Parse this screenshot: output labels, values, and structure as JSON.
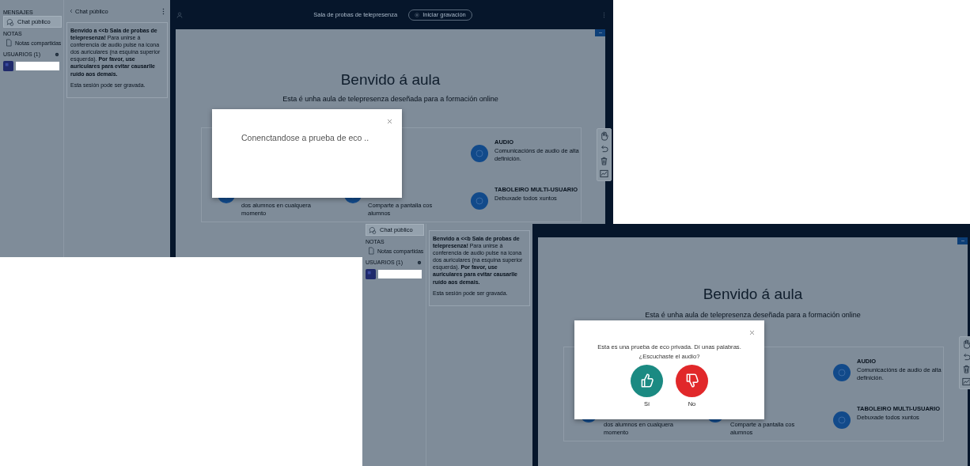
{
  "screenshots": [
    {
      "top_bar": {
        "title": "Sala de probas de telepresenza",
        "record_button": "Iniciar gravación"
      },
      "sidebar": {
        "messages_heading": "MENSAJES",
        "chat_item": {
          "label": "Chat público",
          "selected": true
        },
        "notes_heading": "NOTAS",
        "notes_item": "Notas compartidas",
        "users_heading": "USUARIOS (1)"
      },
      "chat": {
        "header": "Chat público",
        "messages": [
          "**Benvido a <<b Sala de probas de telepresenza!** Para unirse á conferencia de audio pulse na icona dos auriculares (na esquina superior esquerda). **Por favor, use auriculares para evitar causarlle ruído aos demais.**",
          "Esta sesión pode ser gravada."
        ]
      },
      "presentation": {
        "title": "Benvido á aula",
        "subtitle": "Esta é unha aula de telepresenza deseñada para a formación online",
        "features": [
          {
            "description": "dos alumnos en cualquera momento"
          },
          {
            "description": "Comparte a pantalla cos alumnos"
          },
          {
            "title": "AUDIO",
            "description": "Comunicacións de audio de alta definición."
          },
          {
            "title": "TABOLEIRO MULTI-USUARIO",
            "description": "Debuxade todos xuntos"
          }
        ]
      },
      "modal": {
        "kind": "connecting",
        "message": "Conenctandose a prueba de eco .."
      }
    },
    {
      "sidebar": {
        "chat_item": {
          "label": "Chat público",
          "selected": true
        },
        "notes_heading": "NOTAS",
        "notes_item": "Notas compartidas",
        "users_heading": "USUARIOS (1)"
      },
      "chat": {
        "messages": [
          "**Benvido a <<b Sala de probas de telepresenza!** Para unirse á conferencia de audio pulse na icona dos auriculares (na esquina superior esquerda). **Por favor, use auriculares para evitar causarlle ruído aos demais.**",
          "Esta sesión pode ser gravada."
        ]
      },
      "presentation": {
        "title": "Benvido á aula",
        "subtitle": "Esta é unha aula de telepresenza deseñada para a formación online",
        "features": [
          {
            "description": "dos alumnos en cualquera momento"
          },
          {
            "description": "Comparte a pantalla cos alumnos"
          },
          {
            "title": "AUDIO",
            "description": "Comunicacións de audio de alta definición."
          },
          {
            "title": "TABOLEIRO MULTI-USUARIO",
            "description": "Debuxade todos xuntos"
          }
        ]
      },
      "modal": {
        "kind": "echo_test",
        "message": "Esta es una prueba de eco privada. Dí unas palabras. ¿Escuchaste el audio?",
        "answers": [
          {
            "kind": "yes",
            "label": "Sí",
            "color": "#1b8a82"
          },
          {
            "kind": "no",
            "label": "No",
            "color": "#e1282a"
          }
        ]
      }
    }
  ]
}
